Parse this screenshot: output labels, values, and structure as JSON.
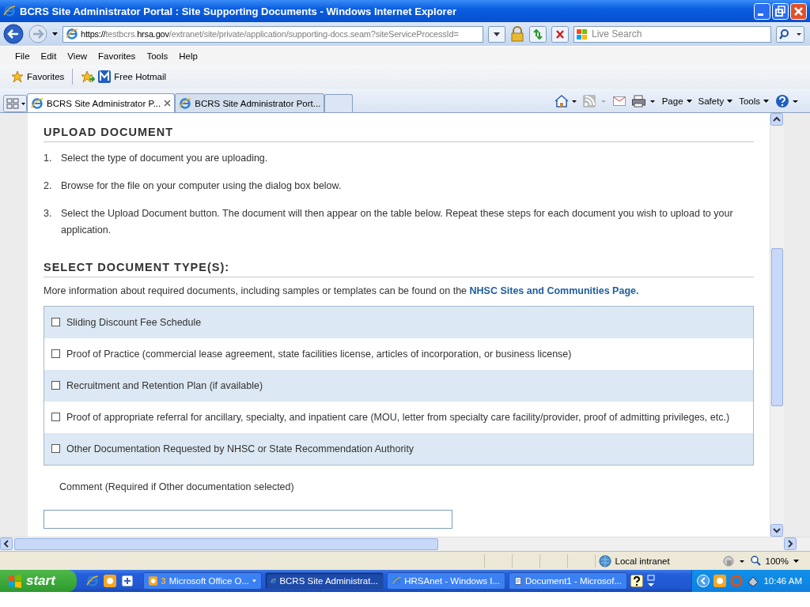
{
  "window": {
    "title": "BCRS Site Administrator Portal : Site Supporting Documents - Windows Internet Explorer"
  },
  "address_bar": {
    "parts": [
      {
        "text": "https://",
        "emphasized": true
      },
      {
        "text": "testbcrs.",
        "emphasized": false
      },
      {
        "text": "hrsa.gov",
        "emphasized": true
      },
      {
        "text": "/extranet/site/private/application/supporting-docs.seam?siteServiceProcessId=",
        "emphasized": false
      }
    ],
    "search_placeholder": "Live Search"
  },
  "menu": [
    "File",
    "Edit",
    "View",
    "Favorites",
    "Tools",
    "Help"
  ],
  "favorites_bar": {
    "label": "Favorites",
    "links": [
      "Free Hotmail"
    ]
  },
  "tabs": [
    {
      "label": "BCRS Site Administrator P...",
      "selected": true
    },
    {
      "label": "BCRS Site Administrator Port...",
      "selected": false
    }
  ],
  "command_bar": [
    "Page",
    "Safety",
    "Tools"
  ],
  "content": {
    "upload_heading": "UPLOAD DOCUMENT",
    "steps": [
      {
        "number": "1.",
        "text": "Select the type of document you are uploading."
      },
      {
        "number": "2.",
        "text": "Browse for the file on your computer using the dialog box below."
      },
      {
        "number": "3.",
        "text": "Select the Upload Document button. The document will then appear on the table below. Repeat these steps for each document you wish to upload to your application."
      }
    ],
    "select_heading": "SELECT DOCUMENT TYPE(S):",
    "info_text": "More information about required documents, including samples or templates can be found on the",
    "info_link": "NHSC Sites and Communities Page.",
    "document_types": [
      {
        "label": "Sliding Discount Fee Schedule",
        "checked": false
      },
      {
        "label": "Proof of Practice (commercial lease agreement, state facilities license, articles of incorporation, or business license)",
        "checked": false
      },
      {
        "label": "Recruitment and Retention Plan (if available)",
        "checked": false
      },
      {
        "label": "Proof of appropriate referral for ancillary, specialty, and inpatient care (MOU, letter from specialty care facility/provider, proof of admitting privileges, etc.)",
        "checked": false
      },
      {
        "label": "Other Documentation Requested by NHSC or State Recommendation Authority",
        "checked": false
      }
    ],
    "comment_label": "Comment (Required if Other documentation selected)"
  },
  "status_bar": {
    "zone": "Local intranet",
    "zoom": "100%"
  },
  "taskbar": {
    "start": "start",
    "tasks": [
      {
        "count": "3",
        "label": "Microsoft Office O...",
        "selected": false
      },
      {
        "label": "BCRS Site Administrat...",
        "selected": true
      },
      {
        "label": "HRSAnet - Windows I...",
        "selected": false
      },
      {
        "label": "Document1 - Microsof...",
        "selected": false
      }
    ],
    "clock": "10:46 AM"
  }
}
